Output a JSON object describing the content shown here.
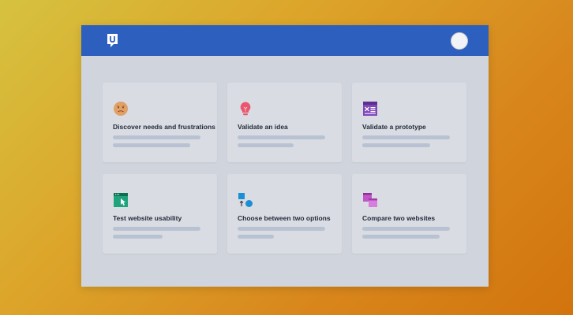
{
  "colors": {
    "titlebar": "#2d5fbe",
    "window": "#d0d5dd",
    "card": "#d9dde3",
    "placeholder_line": "#b9c2d2",
    "title_text": "#232a3a"
  },
  "header": {
    "logo_icon": "u-speech-bubble-logo",
    "logo_letter": "U",
    "avatar_icon": "user-avatar"
  },
  "cards": [
    {
      "title": "Discover needs and frustrations",
      "icon": "frustrated-face-icon",
      "icon_color": "#e0a066"
    },
    {
      "title": "Validate an idea",
      "icon": "lightbulb-icon",
      "icon_color": "#e9566e"
    },
    {
      "title": "Validate a prototype",
      "icon": "prototype-wireframe-icon",
      "icon_color": "#8047b8"
    },
    {
      "title": "Test website usability",
      "icon": "browser-cursor-icon",
      "icon_color": "#1fa37e"
    },
    {
      "title": "Choose between two options",
      "icon": "shapes-choice-icon",
      "icon_color": "#1b8fd3"
    },
    {
      "title": "Compare two websites",
      "icon": "stacked-pages-icon",
      "icon_color": "#c057c8"
    }
  ]
}
